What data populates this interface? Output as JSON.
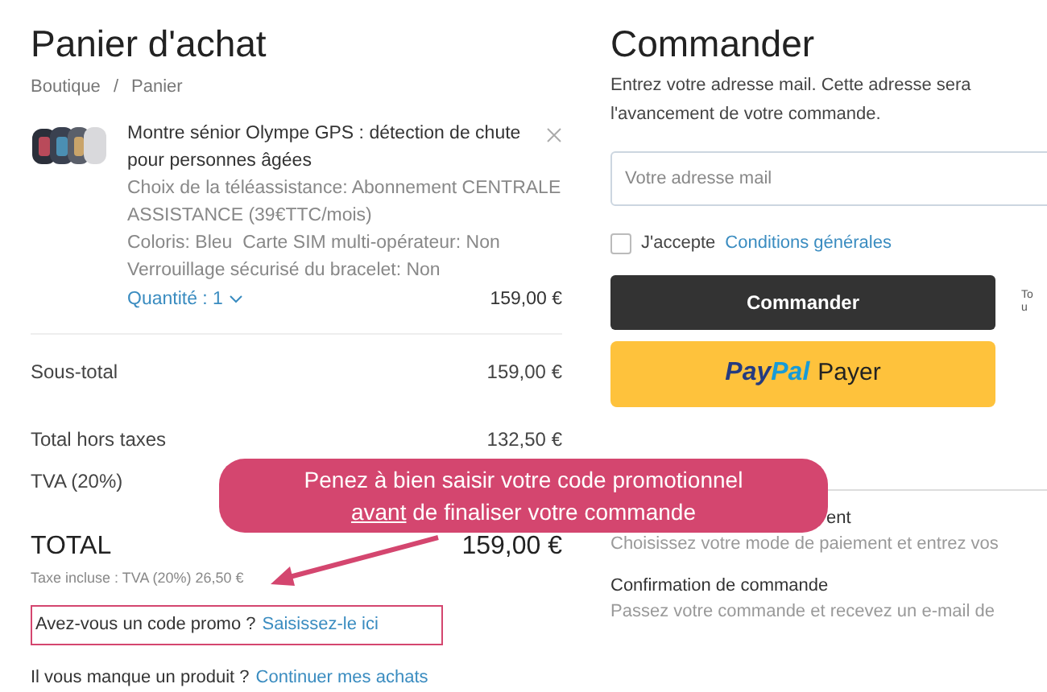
{
  "cart": {
    "title": "Panier d'achat",
    "breadcrumb": [
      {
        "label": "Boutique"
      },
      {
        "separator": "/",
        "label": "Panier"
      }
    ],
    "product": {
      "kind": "picture",
      "name": "Montre sénior Olympe GPS : détection de chute pour personnes âgées",
      "options": [
        "Choix de la téléassistance: Abonnement CENTRALE ASSISTANCE (39€TTC/mois)",
        "Coloris: Bleu  Carte SIM multi-opérateur: Non",
        "Verrouillage sécurisé du bracelet: Non"
      ],
      "quantity": "Quantité : 1",
      "price": "159,00 €"
    },
    "subtotal": {
      "label": "Sous-total",
      "value": "159,00 €"
    },
    "tax_lines": [
      {
        "label": "Total hors taxes",
        "value": "132,50 €"
      },
      {
        "label": "TVA (20%)"
      }
    ],
    "total": {
      "label": "TOTAL",
      "value": "159,00 €",
      "note": "Taxe incluse : TVA (20%) 26,50 €"
    },
    "promo": {
      "question": "Avez-vous un code promo ?",
      "link": "Saisissez-le ici"
    },
    "continue": {
      "question": "Il vous manque un produit ?",
      "link": "Continuer mes achats"
    }
  },
  "checkout": {
    "title": "Commander",
    "intro": [
      "Entrez votre adresse mail. Cette adresse sera",
      "l'avancement de votre commande."
    ],
    "email": {
      "placeholder": "Votre adresse mail"
    },
    "terms": {
      "checked": false,
      "label": "J'accepte",
      "link": "Conditions générales"
    },
    "order_button": "Commander",
    "side_note": [
      "To",
      "u"
    ],
    "paypal": {
      "brand_a": "Pay",
      "brand_b": "Pal",
      "label": "Payer"
    },
    "steps": [
      {
        "title": "ent",
        "description": "Choisissez votre mode de paiement et entrez vos"
      },
      {
        "title": "Confirmation de commande",
        "description": "Passez votre commande et recevez un e-mail de"
      }
    ]
  },
  "callout": {
    "lines": [
      "Penez à bien saisir votre code promotionnel",
      "**avant** de finaliser votre commande"
    ]
  }
}
